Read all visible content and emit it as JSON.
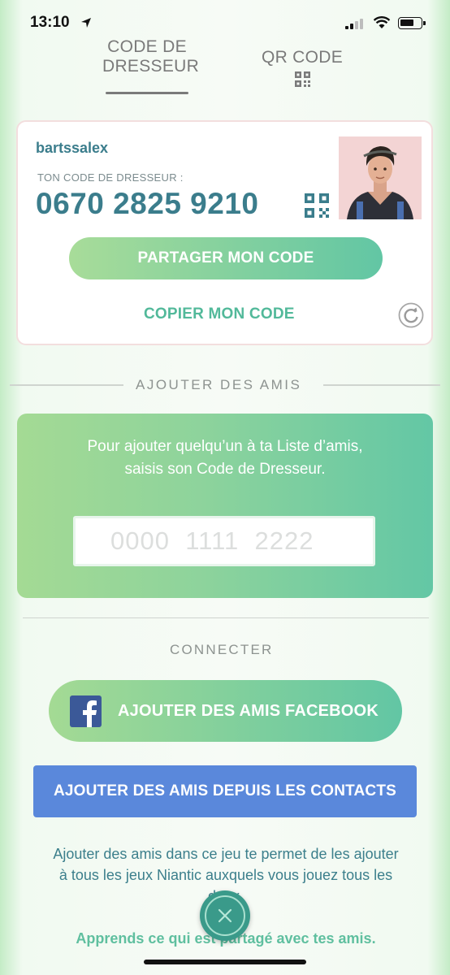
{
  "status_bar": {
    "time": "13:10",
    "icons": [
      "location-arrow-icon",
      "signal-icon",
      "wifi-icon",
      "battery-icon"
    ]
  },
  "tabs": [
    {
      "label": "CODE DE DRESSEUR",
      "line1": "CODE DE",
      "line2": "DRESSEUR",
      "selected": true
    },
    {
      "label": "QR CODE",
      "icon": "qr-code-icon",
      "selected": false
    }
  ],
  "profile_card": {
    "username": "bartssalex",
    "code_caption": "TON CODE DE DRESSEUR :",
    "trainer_code": "0670 2825 9210",
    "share_button": "PARTAGER MON CODE",
    "copy_button": "COPIER MON CODE"
  },
  "add_friends": {
    "section_title": "AJOUTER DES AMIS",
    "instruction": "Pour ajouter quelqu’un à ta Liste d’amis, saisis son Code de Dresseur.",
    "input_placeholder": "0000  1111  2222"
  },
  "connect": {
    "section_title": "CONNECTER",
    "facebook_button": "AJOUTER DES AMIS FACEBOOK",
    "contacts_button": "AJOUTER DES AMIS DEPUIS LES CONTACTS",
    "info_text": "Ajouter des amis dans ce jeu te permet de les ajouter à tous les jeux Niantic auxquels vous jouez tous les deux.",
    "learn_more_link": "Apprends ce qui est partagé avec tes amis."
  },
  "colors": {
    "accent_teal": "#3b7d8c",
    "gradient_start": "#a4da94",
    "gradient_end": "#62c6a4",
    "contacts_blue": "#5a88db"
  }
}
